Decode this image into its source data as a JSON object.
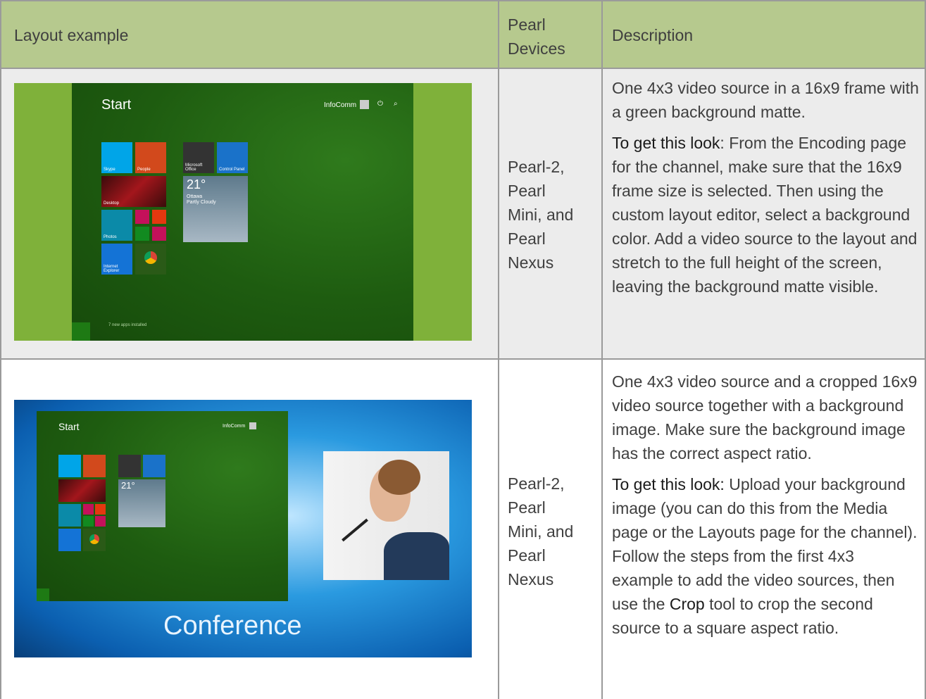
{
  "table": {
    "headers": {
      "col1": "Layout example",
      "col2_line1": "Pearl",
      "col2_line2": "Devices",
      "col3": "Description"
    },
    "rows": [
      {
        "devices": [
          "Pearl-2,",
          "Pearl",
          "Mini, and",
          "Pearl",
          "Nexus"
        ],
        "screenshot": {
          "start_label": "Start",
          "user_label": "InfoComm",
          "weather_temp": "21°",
          "weather_city": "Ottawa",
          "weather_cond": "Partly Cloudy",
          "apps_notice": "7 new apps installed",
          "tiles": [
            "Skype",
            "People",
            "Microsoft Office",
            "Control Panel",
            "Desktop",
            "Photos",
            "Internet Explorer",
            "Google Chrome",
            "Weather"
          ]
        },
        "desc_p1": "One 4x3 video source in a 16x9 frame with a green background matte.",
        "desc_p2_bold": "To get this look",
        "desc_p2_rest": ": From the Encoding page for the channel, make sure that the 16x9 frame size is selected. Then using the custom layout editor, select a background color. Add a video source to the layout and stretch to the full height of the screen, leaving the background matte visible."
      },
      {
        "devices": [
          "Pearl-2,",
          "Pearl",
          "Mini, and",
          "Pearl",
          "Nexus"
        ],
        "screenshot": {
          "start_label": "Start",
          "user_label": "InfoComm",
          "weather_temp": "21°",
          "caption": "Conference"
        },
        "desc_p1": "One 4x3 video source and a cropped 16x9 video source together with a background image. Make sure the background image has the correct aspect ratio.",
        "desc_p2_bold": "To get this look:",
        "desc_p2_rest_a": " Upload your background image (you can do this from the Media page or the Layouts page for the channel). Follow the steps from the first 4x3 example to add the video sources, then use the ",
        "desc_p2_bold2": "Crop",
        "desc_p2_rest_b": " tool to crop the second source to a square aspect ratio."
      }
    ]
  },
  "colors": {
    "header_bg": "#b6c98e",
    "row1_bg": "#ececec",
    "matte_green": "#7fb13a",
    "start_green": "#1e5c10"
  }
}
